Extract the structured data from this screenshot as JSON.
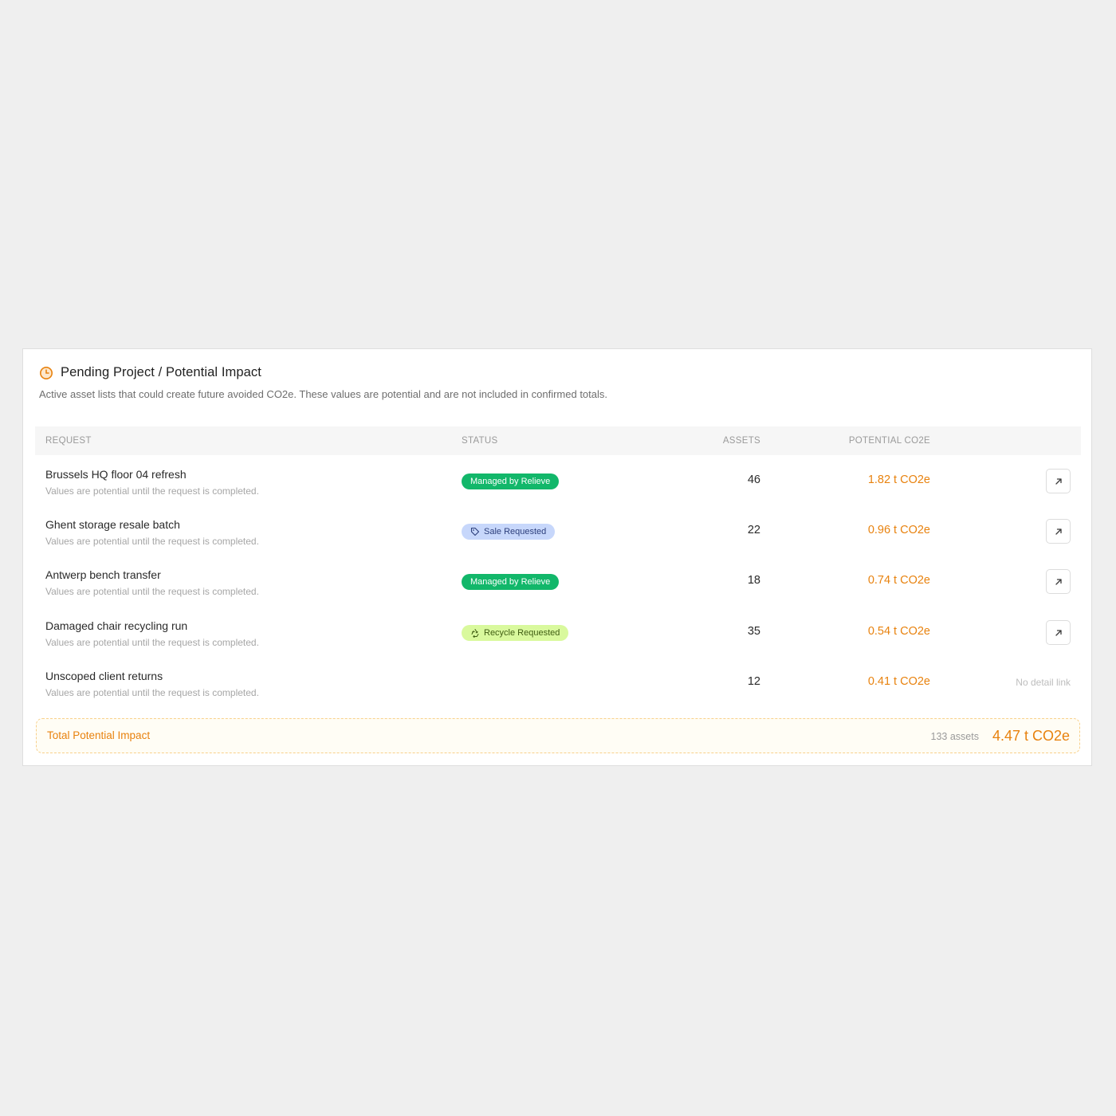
{
  "panel": {
    "title": "Pending Project / Potential Impact",
    "subtitle": "Active asset lists that could create future avoided CO2e. These values are potential and are not included in confirmed totals.",
    "icon": "clock-icon",
    "accent_color": "#e8820e"
  },
  "table": {
    "columns": {
      "request": "REQUEST",
      "status": "STATUS",
      "assets": "ASSETS",
      "potential": "POTENTIAL CO2E"
    },
    "rows": [
      {
        "name": "Brussels HQ floor 04 refresh",
        "note": "Values are potential until the request is completed.",
        "status": "Managed by Relieve",
        "status_type": "managed",
        "assets": "46",
        "co2": "1.82 t CO2e",
        "detail": "link"
      },
      {
        "name": "Ghent storage resale batch",
        "note": "Values are potential until the request is completed.",
        "status": "Sale Requested",
        "status_type": "sale",
        "assets": "22",
        "co2": "0.96 t CO2e",
        "detail": "link"
      },
      {
        "name": "Antwerp bench transfer",
        "note": "Values are potential until the request is completed.",
        "status": "Managed by Relieve",
        "status_type": "managed",
        "assets": "18",
        "co2": "0.74 t CO2e",
        "detail": "link"
      },
      {
        "name": "Damaged chair recycling run",
        "note": "Values are potential until the request is completed.",
        "status": "Recycle Requested",
        "status_type": "recycle",
        "assets": "35",
        "co2": "0.54 t CO2e",
        "detail": "link"
      },
      {
        "name": "Unscoped client returns",
        "note": "Values are potential until the request is completed.",
        "status": "",
        "status_type": "none",
        "assets": "12",
        "co2": "0.41 t CO2e",
        "detail": "No detail link"
      }
    ]
  },
  "total": {
    "label": "Total Potential Impact",
    "assets": "133 assets",
    "value": "4.47 t CO2e"
  },
  "colors": {
    "managed": "#12b76a",
    "sale": "#c7d7fb",
    "recycle": "#d9f99d",
    "co2": "#e8820e"
  }
}
